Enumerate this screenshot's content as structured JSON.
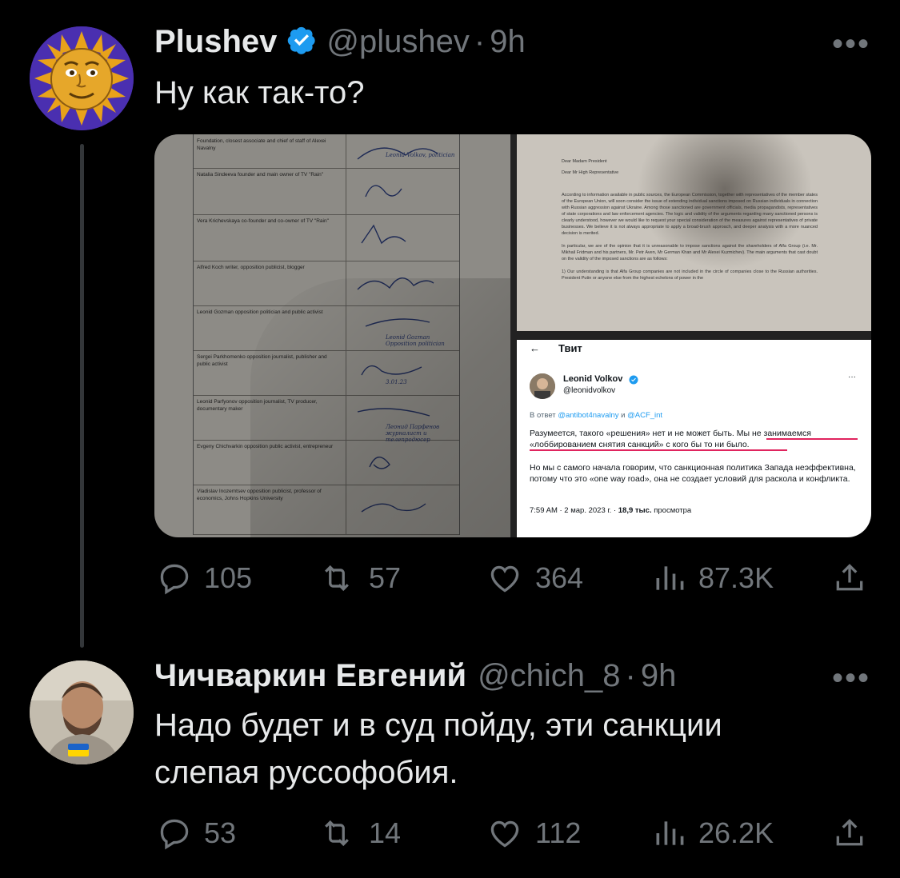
{
  "tweet1": {
    "name": "Plushev",
    "handle": "@plushev",
    "time": "9h",
    "text": "Ну как так-то?",
    "more": "•••",
    "replies": "105",
    "retweets": "57",
    "likes": "364",
    "views": "87.3K"
  },
  "doc_left": {
    "rows": [
      {
        "who": "Foundation, closest associate and chief of staff of Alexei Navalny",
        "sig_text": "Leonid Volkov, politician"
      },
      {
        "who": "Natalia Sindeeva founder and main owner of TV \"Rain\"",
        "sig_text": ""
      },
      {
        "who": "Vera Krichevskaya co-founder and co-owner of TV \"Rain\"",
        "sig_text": ""
      },
      {
        "who": "Alfred Koch writer, opposition publicist, blogger",
        "sig_text": ""
      },
      {
        "who": "Leonid Gozman opposition politician and public activist",
        "sig_text": "Leonid Gozman Opposition politician"
      },
      {
        "who": "Sergei Parkhomenko opposition journalist, publisher and public activist",
        "sig_text": "3.01.23"
      },
      {
        "who": "Leonid Parfyonov opposition journalist, TV producer, documentary maker",
        "sig_text": "Леонид Парфенов журналист и телепродюсер"
      },
      {
        "who": "Evgeny Chichvarkin opposition public activist, entrepreneur",
        "sig_text": ""
      },
      {
        "who": "Vladislav Inozemtsev opposition publicist, professor of economics, Johns Hopkins University",
        "sig_text": ""
      }
    ]
  },
  "letter": {
    "salutation1": "Dear Madam President",
    "salutation2": "Dear Mr High Representative",
    "para1": "According to information available in public sources, the European Commission, together with representatives of the member states of the European Union, will soon consider the issue of extending individual sanctions imposed on Russian individuals in connection with Russian aggression against Ukraine. Among those sanctioned are government officials, media propagandists, representatives of state corporations and law enforcement agencies. The logic and validity of the arguments regarding many sanctioned persons is clearly understood, however we would like to request your special consideration of the measures against representatives of private businesses. We believe it is not always appropriate to apply a broad-brush approach, and deeper analysis with a more nuanced decision is merited.",
    "para2": "In particular, we are of the opinion that it is unreasonable to impose sanctions against the shareholders of Alfa Group (i.e. Mr. Mikhail Fridman and his partners, Mr. Petr Aven, Mr German Khan and Mr Alexei Kuzmichev). The main arguments that cast doubt on the validity of the imposed sanctions are as follows:",
    "para3": "1) Our understanding is that Alfa Group companies are not included in the circle of companies close to the Russian authorities. President Putin or anyone else from the highest echelons of power in the"
  },
  "embedded_tweet": {
    "back": "←",
    "header": "Твит",
    "name": "Leonid Volkov",
    "handle": "@leonidvolkov",
    "reply_prefix": "В ответ",
    "reply_to1": "@antibot4navalny",
    "reply_and": "и",
    "reply_to2": "@ACF_int",
    "p1": "Разумеется, такого «решения» нет и не может быть. Мы не занимаемся «лоббированием снятия санкций» с кого бы то ни было.",
    "p2": "Но мы с самого начала говорим, что санкционная политика Запада неэффективна, потому что это «one way road», она не создает условий для раскола и конфликта.",
    "meta": "7:59 AM · 2 мар. 2023 г. ·",
    "views_num": "18,9 тыс.",
    "views_label": "просмотра"
  },
  "tweet2": {
    "name": "Чичваркин Евгений",
    "handle": "@chich_8",
    "time": "9h",
    "text_line1": "Надо будет и в суд пойду, эти санкции",
    "text_line2": "слепая руссофобия.",
    "more": "•••",
    "replies": "53",
    "retweets": "14",
    "likes": "112",
    "views": "26.2K"
  },
  "colors": {
    "background": "#000000",
    "text": "#e7e9ea",
    "secondary": "#71767b",
    "verified": "#1d9bf0",
    "thread_line": "#333639"
  },
  "icons": [
    "verified-badge-icon",
    "reply-icon",
    "retweet-icon",
    "like-icon",
    "views-icon",
    "share-icon",
    "more-icon"
  ]
}
